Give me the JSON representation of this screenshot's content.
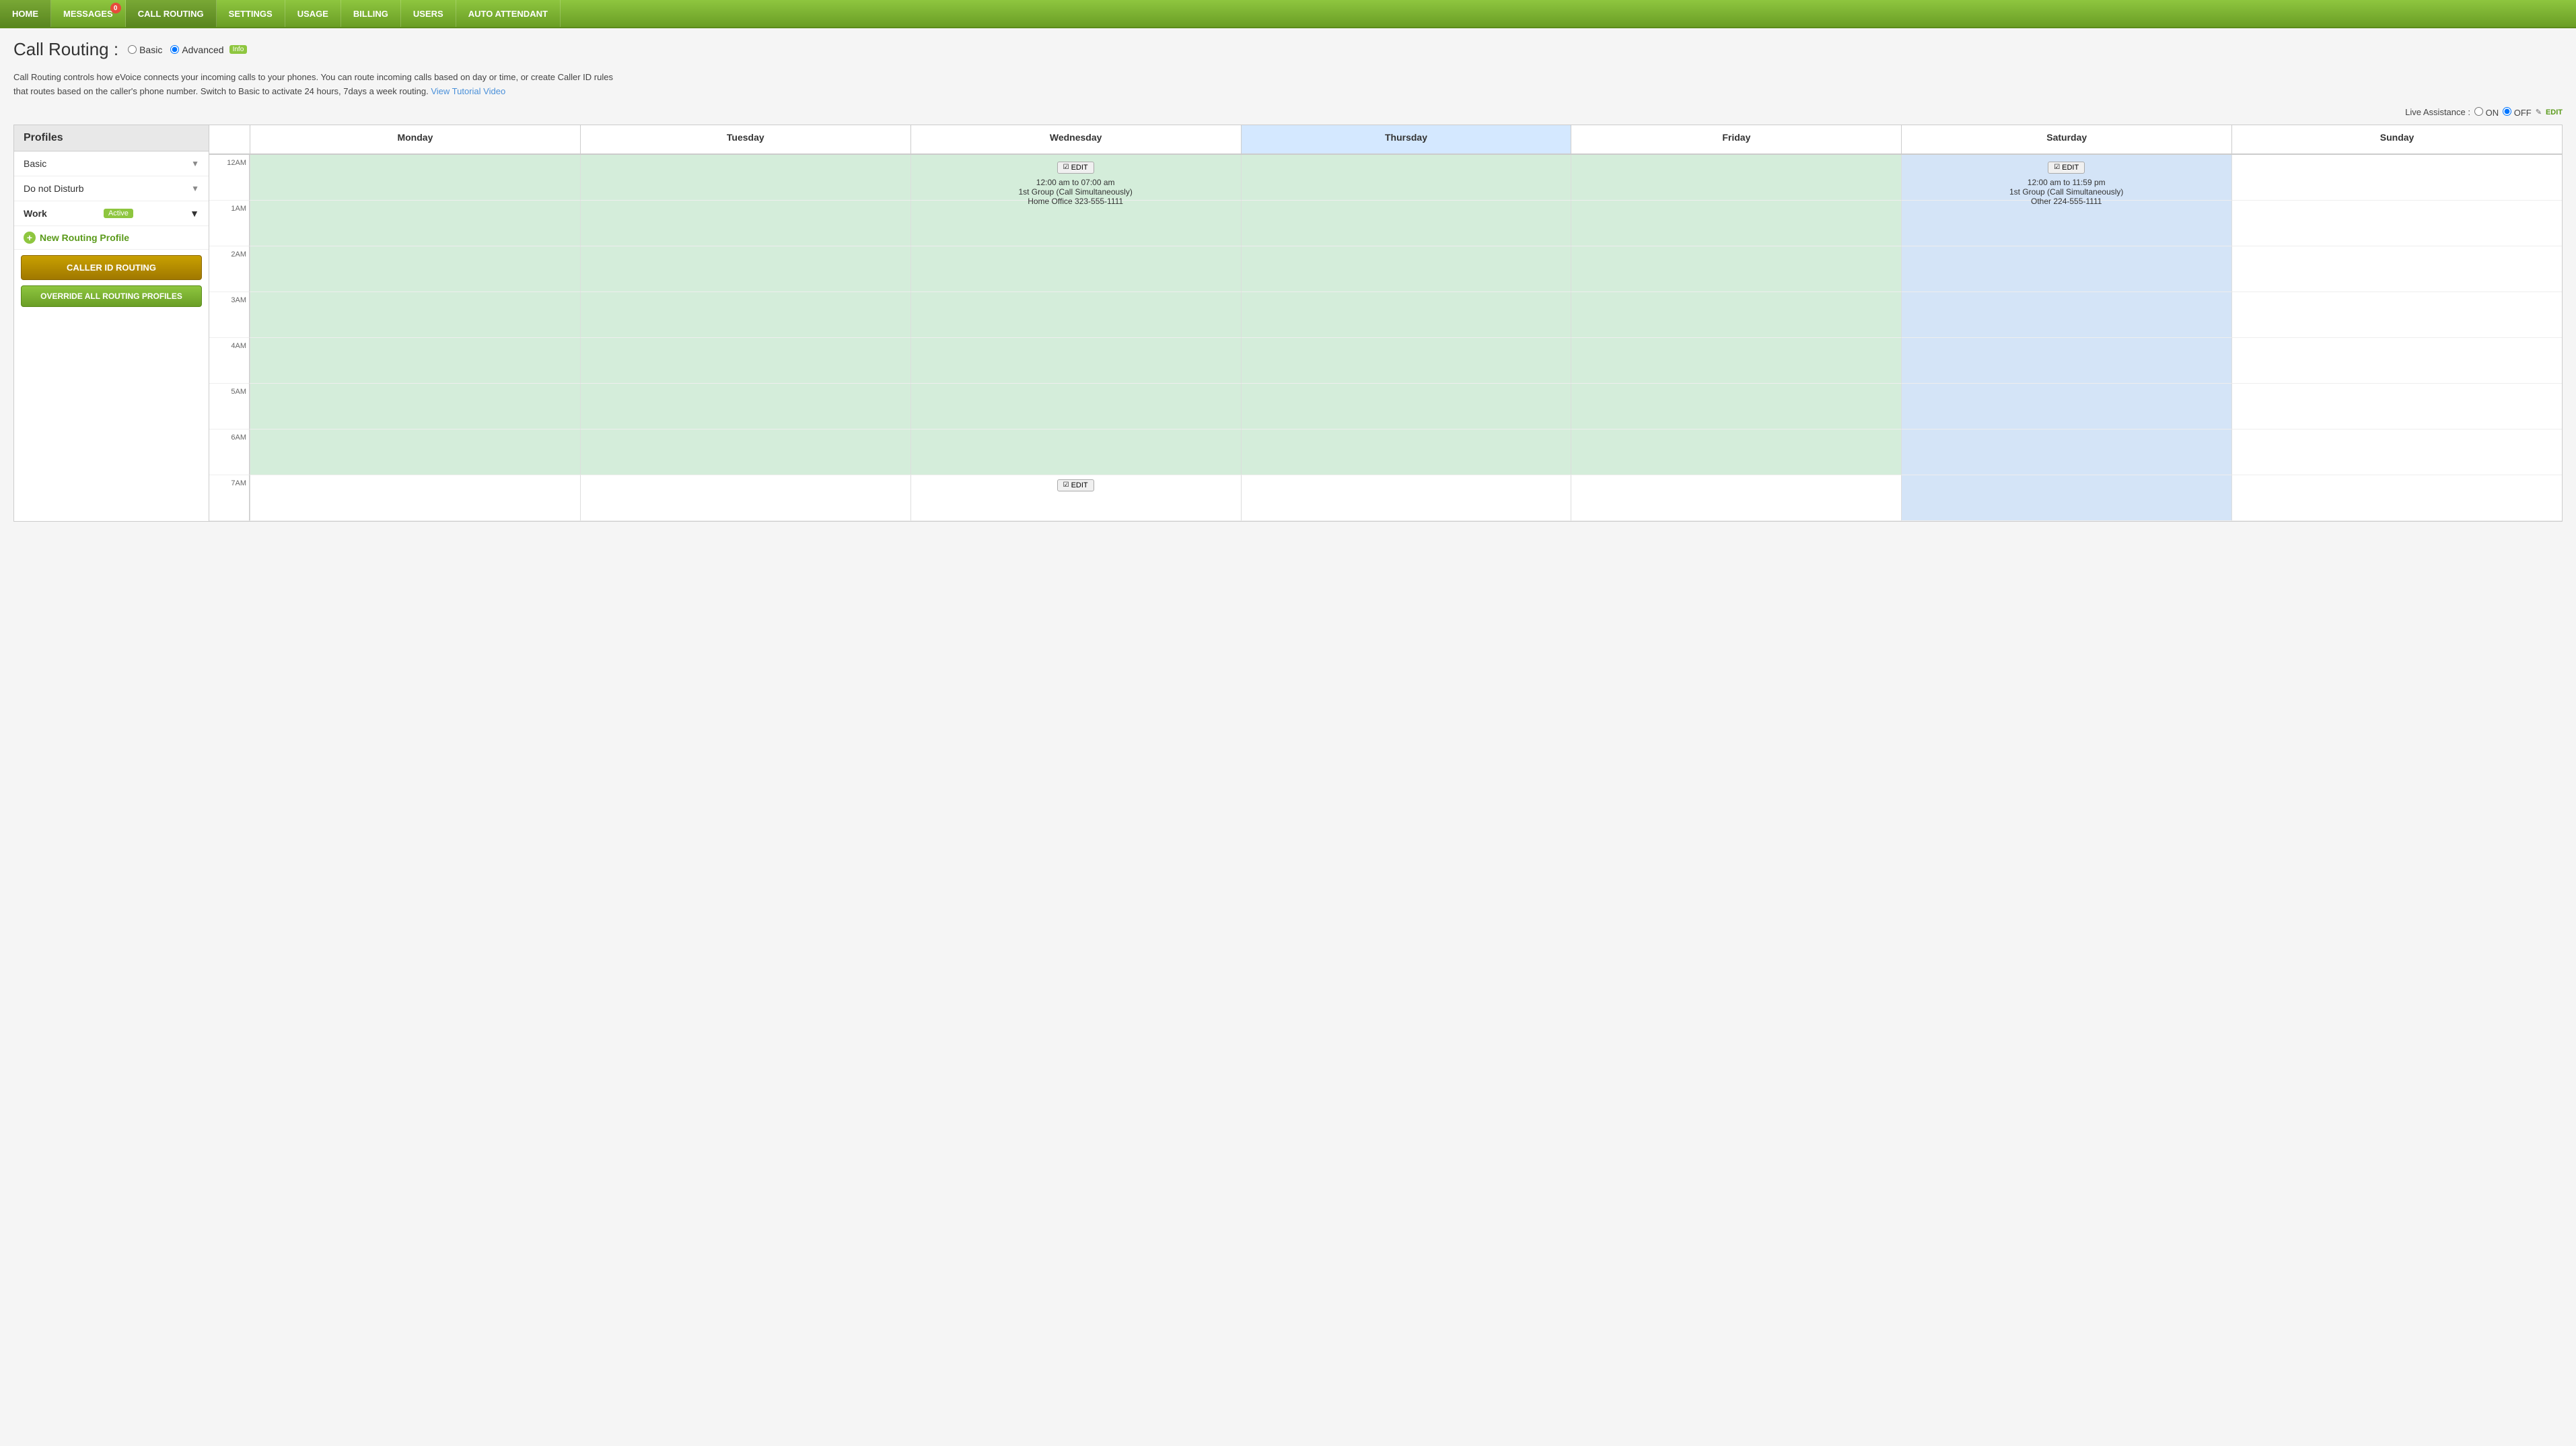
{
  "nav": {
    "items": [
      {
        "label": "HOME",
        "id": "home",
        "badge": null
      },
      {
        "label": "MESSAGES",
        "id": "messages",
        "badge": "0"
      },
      {
        "label": "CALL ROUTING",
        "id": "call-routing",
        "badge": null,
        "active": true
      },
      {
        "label": "SETTINGS",
        "id": "settings",
        "badge": null
      },
      {
        "label": "USAGE",
        "id": "usage",
        "badge": null
      },
      {
        "label": "BILLING",
        "id": "billing",
        "badge": null
      },
      {
        "label": "USERS",
        "id": "users",
        "badge": null
      },
      {
        "label": "AUTO ATTENDANT",
        "id": "auto-attendant",
        "badge": null
      }
    ]
  },
  "header": {
    "title": "Call Routing :",
    "radio_basic": "Basic",
    "radio_advanced": "Advanced",
    "info_label": "Info"
  },
  "description": {
    "text": "Call Routing controls how eVoice connects your incoming calls to your phones. You can route incoming calls based on day or time, or create Caller ID rules that routes based on the caller's phone number. Switch to Basic to activate 24 hours, 7days a week routing.",
    "link_text": "View Tutorial Video"
  },
  "live_assist": {
    "label": "Live Assistance :",
    "on_label": "ON",
    "off_label": "OFF",
    "edit_label": "EDIT"
  },
  "sidebar": {
    "header": "Profiles",
    "items": [
      {
        "label": "Basic",
        "id": "basic"
      },
      {
        "label": "Do not Disturb",
        "id": "do-not-disturb"
      }
    ],
    "work": {
      "label": "Work",
      "status": "Active"
    },
    "new_routing_label": "New Routing Profile",
    "caller_id_label": "CALLER ID ROUTING",
    "override_label": "OVERRIDE ALL ROUTING PROFILES"
  },
  "calendar": {
    "days": [
      "Monday",
      "Tuesday",
      "Wednesday",
      "Thursday",
      "Friday",
      "Saturday",
      "Sunday"
    ],
    "highlight_day": "Thursday",
    "time_slots": [
      "12AM",
      "1AM",
      "2AM",
      "3AM",
      "4AM",
      "5AM",
      "6AM",
      "7AM"
    ],
    "green_block": {
      "edit_label": "EDIT",
      "time": "12:00 am to 07:00 am",
      "group": "1st Group (Call Simultaneously)",
      "phone": "Home Office 323-555-1111"
    },
    "blue_block": {
      "edit_label": "EDIT",
      "time": "12:00 am to 11:59 pm",
      "group": "1st Group (Call Simultaneously)",
      "phone": "Other 224-555-1111"
    },
    "second_edit_label": "EDIT"
  }
}
